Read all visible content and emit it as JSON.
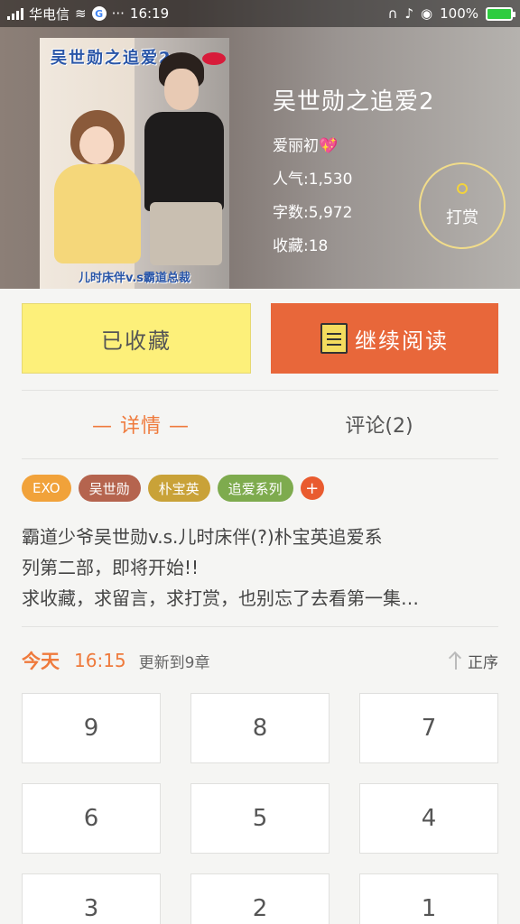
{
  "status_bar": {
    "carrier": "华电信",
    "time": "16:19",
    "battery": "100%"
  },
  "book": {
    "cover_title": "吴世勋之追爱2",
    "cover_bottom": "儿时床伴v.s霸道总裁",
    "title": "吴世勋之追爱2",
    "author": "爱丽初💖",
    "popularity": "人气:1,530",
    "word_count": "字数:5,972",
    "favorites": "收藏:18",
    "tip_label": "打赏"
  },
  "actions": {
    "favorite_label": "已收藏",
    "read_label": "继续阅读"
  },
  "tabs": {
    "detail": "— 详情 —",
    "comments": "评论(2)"
  },
  "tags": [
    {
      "label": "EXO",
      "color": "#f1a23a"
    },
    {
      "label": "吴世勋",
      "color": "#b5644e"
    },
    {
      "label": "朴宝英",
      "color": "#c9a238"
    },
    {
      "label": "追爱系列",
      "color": "#7eab4e"
    }
  ],
  "tag_add": "+",
  "description": {
    "line1": "霸道少爷吴世勋v.s.儿时床伴(?)朴宝英追爱系",
    "line2": "列第二部，即将开始!!",
    "line3": "求收藏，求留言，求打赏，也别忘了去看第一集…"
  },
  "update": {
    "today": "今天",
    "time": "16:15",
    "text": "更新到9章",
    "sort_label": "正序"
  },
  "chapters": [
    "9",
    "8",
    "7",
    "6",
    "5",
    "4",
    "3",
    "2",
    "1"
  ],
  "colors": {
    "accent": "#ef7a3c",
    "read_button": "#e8673a",
    "favorite_button": "#fdf07a"
  }
}
